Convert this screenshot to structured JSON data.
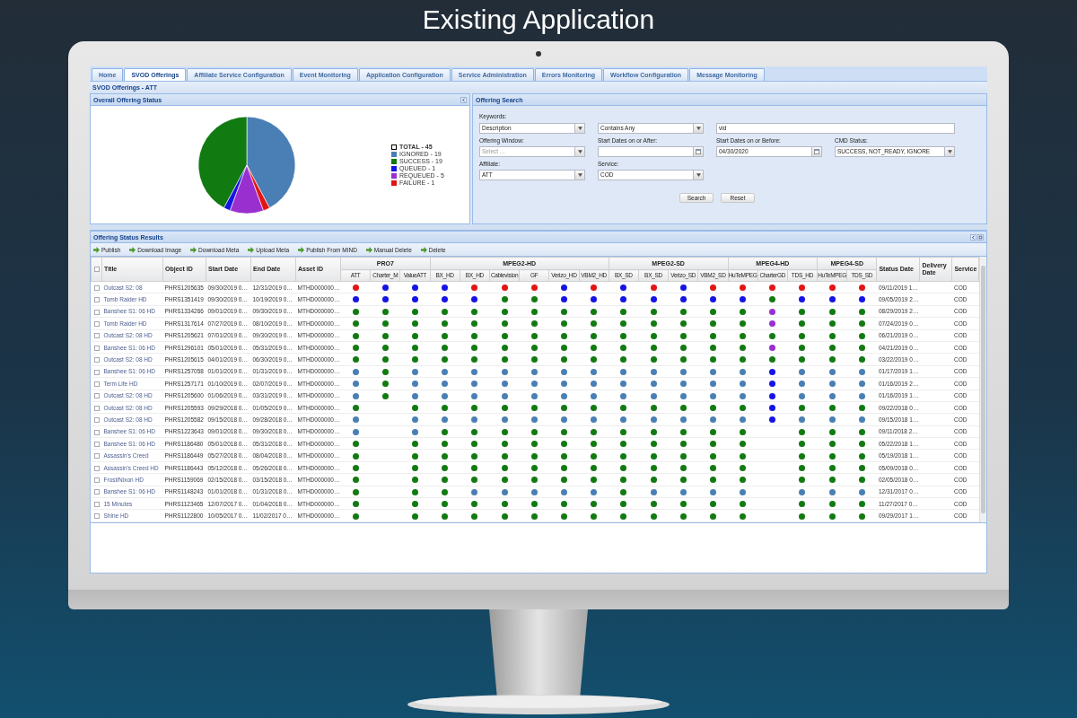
{
  "heading": "Existing Application",
  "tabs": [
    {
      "label": "Home",
      "selected": false
    },
    {
      "label": "SVOD Offerings",
      "selected": true
    },
    {
      "label": "Affiliate Service Configuration",
      "selected": false
    },
    {
      "label": "Event Monitoring",
      "selected": false
    },
    {
      "label": "Application Configuration",
      "selected": false
    },
    {
      "label": "Service Administration",
      "selected": false
    },
    {
      "label": "Errors Monitoring",
      "selected": false
    },
    {
      "label": "Workflow Configuration",
      "selected": false
    },
    {
      "label": "Message Monitoring",
      "selected": false
    }
  ],
  "breadcrumb": "SVOD Offerings - ATT",
  "status_panel": {
    "title": "Overall Offering Status",
    "total_label": "TOTAL - 45",
    "chart_data": {
      "type": "pie",
      "categories": [
        "IGNORED - 19",
        "SUCCESS - 19",
        "QUEUED - 1",
        "REQUEUED - 5",
        "FAILURE - 1"
      ],
      "values": [
        42.2,
        42.2,
        2.2,
        11.2,
        2.2
      ],
      "colors": [
        "#4a7fb5",
        "#117a11",
        "#1414e6",
        "#9a2fd0",
        "#e31414"
      ]
    }
  },
  "search_panel": {
    "title": "Offering Search",
    "keywords": {
      "label": "Keywords:",
      "field": "Description",
      "operator": "Contains Any",
      "value": "vid"
    },
    "filters": [
      {
        "label": "Offering Window:",
        "kind": "select",
        "placeholder": "Select ..."
      },
      {
        "label": "Start Dates on or After:",
        "kind": "date"
      },
      {
        "label": "Start Dates on or Before:",
        "kind": "date",
        "value": "04/30/2020"
      },
      {
        "label": "CMD Status:",
        "kind": "select",
        "value": "SUCCESS, NOT_READY, IGNORE"
      },
      {
        "label": "Affiliate:",
        "kind": "select",
        "value": "ATT"
      },
      {
        "label": "Service:",
        "kind": "select",
        "value": "COD"
      }
    ],
    "buttons": [
      "Search",
      "Reset"
    ]
  },
  "results": {
    "title": "Offering Status Results",
    "toolbar": [
      "Publish",
      "Download Image",
      "Download Meta",
      "Upload Meta",
      "Publish From MIND",
      "Manual Delete",
      "Delete"
    ],
    "table": {
      "select_all_checked": false,
      "lead_columns": [
        "Title",
        "Object ID",
        "Start Date",
        "End Date",
        "Asset ID"
      ],
      "groups": [
        {
          "name": "PRO7",
          "columns": [
            "ATT",
            "Charter_M",
            "ValueATT"
          ]
        },
        {
          "name": "MPEG2-HD",
          "columns": [
            "BX_HD",
            "BX_HD",
            "Cablevision",
            "GF",
            "Verizo_HD",
            "VBM2_HD"
          ]
        },
        {
          "name": "MPEG2-SD",
          "columns": [
            "BX_SD",
            "BX_SD",
            "Verizo_SD",
            "VBM2_SD"
          ]
        },
        {
          "name": "MPEG4-HD",
          "columns": [
            "HuTeMPEG",
            "CharterGD",
            "TDS_HD"
          ]
        },
        {
          "name": "MPEG4-SD",
          "columns": [
            "HuTeMPEG",
            "TDS_SD"
          ]
        }
      ],
      "tail_columns": [
        "Status Date",
        "Delivery Date",
        "Service"
      ],
      "rows": [
        {
          "checked": false,
          "title": "Outcast S2: 08",
          "object_id": "PHRS1205635",
          "start_date": "09/30/2019 0…",
          "end_date": "12/31/2019 0…",
          "asset_id": "MTHD000000…",
          "status_date": "09/11/2019 1…",
          "service": "COD",
          "statuses": [
            {
              "color": "#e31414"
            },
            {
              "color": "#1414e6"
            },
            {
              "color": "#1414e6"
            },
            {
              "color": "#1414e6"
            },
            {
              "color": "#e31414"
            },
            {
              "color": "#e31414"
            },
            {
              "color": "#e31414"
            },
            {
              "color": "#1414e6"
            },
            {
              "color": "#e31414"
            },
            {
              "color": "#1414e6"
            },
            {
              "color": "#e31414"
            },
            {
              "color": "#1414e6"
            },
            {
              "color": "#e31414"
            },
            {
              "color": "#e31414"
            },
            {
              "color": "#e31414"
            },
            {
              "color": "#e31414"
            },
            {
              "color": "#e31414"
            },
            {
              "color": "#e31414"
            }
          ]
        },
        {
          "checked": false,
          "title": "Tomb Raider HD",
          "object_id": "PHRS1351419",
          "start_date": "09/30/2019 0…",
          "end_date": "10/19/2019 0…",
          "asset_id": "MTHD000000…",
          "status_date": "09/05/2019 2…",
          "service": "COD",
          "statuses": [
            {
              "color": "#1414e6"
            },
            {
              "color": "#1414e6"
            },
            {
              "color": "#1414e6"
            },
            {
              "color": "#1414e6"
            },
            {
              "color": "#1414e6"
            },
            {
              "color": "#117a11"
            },
            {
              "color": "#117a11"
            },
            {
              "color": "#1414e6"
            },
            {
              "color": "#1414e6"
            },
            {
              "color": "#1414e6"
            },
            {
              "color": "#1414e6"
            },
            {
              "color": "#1414e6"
            },
            {
              "color": "#1414e6"
            },
            {
              "color": "#1414e6"
            },
            {
              "color": "#117a11"
            },
            {
              "color": "#1414e6"
            },
            {
              "color": "#1414e6"
            },
            {
              "color": "#1414e6"
            }
          ]
        },
        {
          "checked": false,
          "title": "Banshee S1: 06 HD",
          "object_id": "PHRS1334266",
          "start_date": "09/01/2019 0…",
          "end_date": "09/30/2019 0…",
          "asset_id": "MTHD000000…",
          "status_date": "08/29/2019 2…",
          "service": "COD",
          "statuses": [
            {
              "color": "#117a11"
            },
            {
              "color": "#117a11"
            },
            {
              "color": "#117a11"
            },
            {
              "color": "#117a11"
            },
            {
              "color": "#117a11"
            },
            {
              "color": "#117a11"
            },
            {
              "color": "#117a11"
            },
            {
              "color": "#117a11"
            },
            {
              "color": "#117a11"
            },
            {
              "color": "#117a11"
            },
            {
              "color": "#117a11"
            },
            {
              "color": "#117a11"
            },
            {
              "color": "#117a11"
            },
            {
              "color": "#117a11"
            },
            {
              "color": "#9a2fd0"
            },
            {
              "color": "#117a11"
            },
            {
              "color": "#117a11"
            },
            {
              "color": "#117a11"
            }
          ]
        },
        {
          "checked": false,
          "title": "Tomb Raider HD",
          "object_id": "PHRS1317614",
          "start_date": "07/27/2019 0…",
          "end_date": "08/10/2019 0…",
          "asset_id": "MTHD000000…",
          "status_date": "07/24/2019 0…",
          "service": "COD",
          "statuses": [
            {
              "color": "#117a11"
            },
            {
              "color": "#117a11"
            },
            {
              "color": "#117a11"
            },
            {
              "color": "#117a11"
            },
            {
              "color": "#117a11"
            },
            {
              "color": "#117a11"
            },
            {
              "color": "#117a11"
            },
            {
              "color": "#117a11"
            },
            {
              "color": "#117a11"
            },
            {
              "color": "#117a11"
            },
            {
              "color": "#117a11"
            },
            {
              "color": "#117a11"
            },
            {
              "color": "#117a11"
            },
            {
              "color": "#117a11"
            },
            {
              "color": "#9a2fd0"
            },
            {
              "color": "#117a11"
            },
            {
              "color": "#117a11"
            },
            {
              "color": "#117a11"
            }
          ]
        },
        {
          "checked": false,
          "title": "Outcast S2: 08 HD",
          "object_id": "PHRS1205621",
          "start_date": "07/01/2019 0…",
          "end_date": "09/30/2019 0…",
          "asset_id": "MTHD000000…",
          "status_date": "06/21/2019 0…",
          "service": "COD",
          "statuses": [
            {
              "color": "#117a11"
            },
            {
              "color": "#117a11"
            },
            {
              "color": "#117a11"
            },
            {
              "color": "#117a11"
            },
            {
              "color": "#117a11"
            },
            {
              "color": "#117a11"
            },
            {
              "color": "#117a11"
            },
            {
              "color": "#117a11"
            },
            {
              "color": "#117a11"
            },
            {
              "color": "#117a11"
            },
            {
              "color": "#117a11"
            },
            {
              "color": "#117a11"
            },
            {
              "color": "#117a11"
            },
            {
              "color": "#117a11"
            },
            {
              "color": "#117a11"
            },
            {
              "color": "#117a11"
            },
            {
              "color": "#117a11"
            },
            {
              "color": "#117a11"
            }
          ]
        },
        {
          "checked": false,
          "title": "Banshee S1: 06 HD",
          "object_id": "PHRS1296101",
          "start_date": "05/01/2019 0…",
          "end_date": "05/31/2019 0…",
          "asset_id": "MTHD000000…",
          "status_date": "04/21/2019 0…",
          "service": "COD",
          "statuses": [
            {
              "color": "#117a11"
            },
            {
              "color": "#117a11"
            },
            {
              "color": "#117a11"
            },
            {
              "color": "#117a11"
            },
            {
              "color": "#117a11"
            },
            {
              "color": "#117a11"
            },
            {
              "color": "#117a11"
            },
            {
              "color": "#117a11"
            },
            {
              "color": "#117a11"
            },
            {
              "color": "#117a11"
            },
            {
              "color": "#117a11"
            },
            {
              "color": "#117a11"
            },
            {
              "color": "#117a11"
            },
            {
              "color": "#117a11"
            },
            {
              "color": "#9a2fd0"
            },
            {
              "color": "#117a11"
            },
            {
              "color": "#117a11"
            },
            {
              "color": "#117a11"
            }
          ]
        },
        {
          "checked": false,
          "title": "Outcast S2: 08 HD",
          "object_id": "PHRS1205615",
          "start_date": "04/01/2019 0…",
          "end_date": "06/30/2019 0…",
          "asset_id": "MTHD000000…",
          "status_date": "03/22/2019 0…",
          "service": "COD",
          "statuses": [
            {
              "color": "#117a11"
            },
            {
              "color": "#117a11"
            },
            {
              "color": "#117a11"
            },
            {
              "color": "#117a11"
            },
            {
              "color": "#117a11"
            },
            {
              "color": "#117a11"
            },
            {
              "color": "#117a11"
            },
            {
              "color": "#117a11"
            },
            {
              "color": "#117a11"
            },
            {
              "color": "#117a11"
            },
            {
              "color": "#117a11"
            },
            {
              "color": "#117a11"
            },
            {
              "color": "#117a11"
            },
            {
              "color": "#117a11"
            },
            {
              "color": "#117a11"
            },
            {
              "color": "#117a11"
            },
            {
              "color": "#117a11"
            },
            {
              "color": "#117a11"
            }
          ]
        },
        {
          "checked": false,
          "title": "Banshee S1: 06 HD",
          "object_id": "PHRS1257058",
          "start_date": "01/01/2019 0…",
          "end_date": "01/31/2019 0…",
          "asset_id": "MTHD000000…",
          "status_date": "01/17/2019 1…",
          "service": "COD",
          "statuses": [
            {
              "color": "#4a7fb5"
            },
            {
              "color": "#117a11"
            },
            {
              "color": "#4a7fb5"
            },
            {
              "color": "#4a7fb5"
            },
            {
              "color": "#4a7fb5"
            },
            {
              "color": "#4a7fb5"
            },
            {
              "color": "#4a7fb5"
            },
            {
              "color": "#4a7fb5"
            },
            {
              "color": "#4a7fb5"
            },
            {
              "color": "#4a7fb5"
            },
            {
              "color": "#4a7fb5"
            },
            {
              "color": "#4a7fb5"
            },
            {
              "color": "#4a7fb5"
            },
            {
              "color": "#4a7fb5"
            },
            {
              "color": "#1414e6"
            },
            {
              "color": "#4a7fb5"
            },
            {
              "color": "#4a7fb5"
            },
            {
              "color": "#4a7fb5"
            }
          ]
        },
        {
          "checked": false,
          "title": "Term Life HD",
          "object_id": "PHRS1257171",
          "start_date": "01/10/2019 0…",
          "end_date": "02/07/2019 0…",
          "asset_id": "MTHD000000…",
          "status_date": "01/16/2019 2…",
          "service": "COD",
          "statuses": [
            {
              "color": "#4a7fb5"
            },
            {
              "color": "#117a11"
            },
            {
              "color": "#4a7fb5"
            },
            {
              "color": "#4a7fb5"
            },
            {
              "color": "#4a7fb5"
            },
            {
              "color": "#4a7fb5"
            },
            {
              "color": "#4a7fb5"
            },
            {
              "color": "#4a7fb5"
            },
            {
              "color": "#4a7fb5"
            },
            {
              "color": "#4a7fb5"
            },
            {
              "color": "#4a7fb5"
            },
            {
              "color": "#4a7fb5"
            },
            {
              "color": "#4a7fb5"
            },
            {
              "color": "#4a7fb5"
            },
            {
              "color": "#1414e6"
            },
            {
              "color": "#4a7fb5"
            },
            {
              "color": "#4a7fb5"
            },
            {
              "color": "#4a7fb5"
            }
          ]
        },
        {
          "checked": false,
          "title": "Outcast S2: 08 HD",
          "object_id": "PHRS1205600",
          "start_date": "01/06/2019 0…",
          "end_date": "03/31/2019 0…",
          "asset_id": "MTHD000000…",
          "status_date": "01/16/2019 1…",
          "service": "COD",
          "statuses": [
            {
              "color": "#4a7fb5"
            },
            {
              "color": "#117a11"
            },
            {
              "color": "#4a7fb5"
            },
            {
              "color": "#4a7fb5"
            },
            {
              "color": "#4a7fb5"
            },
            {
              "color": "#4a7fb5"
            },
            {
              "color": "#4a7fb5"
            },
            {
              "color": "#4a7fb5"
            },
            {
              "color": "#4a7fb5"
            },
            {
              "color": "#4a7fb5"
            },
            {
              "color": "#4a7fb5"
            },
            {
              "color": "#4a7fb5"
            },
            {
              "color": "#4a7fb5"
            },
            {
              "color": "#4a7fb5"
            },
            {
              "color": "#1414e6"
            },
            {
              "color": "#4a7fb5"
            },
            {
              "color": "#4a7fb5"
            },
            {
              "color": "#4a7fb5"
            }
          ]
        },
        {
          "checked": false,
          "title": "Outcast S2: 08 HD",
          "object_id": "PHRS1205593",
          "start_date": "09/29/2018 0…",
          "end_date": "01/05/2019 0…",
          "asset_id": "MTHD000000…",
          "status_date": "09/22/2018 0…",
          "service": "COD",
          "statuses": [
            {
              "color": "#117a11"
            },
            {
              "empty": true
            },
            {
              "color": "#117a11"
            },
            {
              "color": "#117a11"
            },
            {
              "color": "#117a11"
            },
            {
              "color": "#117a11"
            },
            {
              "color": "#117a11"
            },
            {
              "color": "#117a11"
            },
            {
              "color": "#117a11"
            },
            {
              "color": "#117a11"
            },
            {
              "color": "#117a11"
            },
            {
              "color": "#117a11"
            },
            {
              "color": "#117a11"
            },
            {
              "color": "#117a11"
            },
            {
              "color": "#1414e6"
            },
            {
              "color": "#117a11"
            },
            {
              "color": "#117a11"
            },
            {
              "color": "#117a11"
            }
          ]
        },
        {
          "checked": false,
          "title": "Outcast S2: 08 HD",
          "object_id": "PHRS1205582",
          "start_date": "09/15/2018 0…",
          "end_date": "09/28/2018 0…",
          "asset_id": "MTHD000000…",
          "status_date": "09/15/2018 1…",
          "service": "COD",
          "statuses": [
            {
              "color": "#4a7fb5"
            },
            {
              "empty": true
            },
            {
              "color": "#4a7fb5"
            },
            {
              "color": "#4a7fb5"
            },
            {
              "color": "#4a7fb5"
            },
            {
              "color": "#4a7fb5"
            },
            {
              "color": "#4a7fb5"
            },
            {
              "color": "#4a7fb5"
            },
            {
              "color": "#4a7fb5"
            },
            {
              "color": "#4a7fb5"
            },
            {
              "color": "#4a7fb5"
            },
            {
              "color": "#4a7fb5"
            },
            {
              "color": "#4a7fb5"
            },
            {
              "color": "#4a7fb5"
            },
            {
              "color": "#1414e6"
            },
            {
              "color": "#4a7fb5"
            },
            {
              "color": "#4a7fb5"
            },
            {
              "color": "#4a7fb5"
            }
          ]
        },
        {
          "checked": false,
          "title": "Banshee S1: 06 HD",
          "object_id": "PHRS1223643",
          "start_date": "09/01/2018 0…",
          "end_date": "09/30/2018 0…",
          "asset_id": "MTHD000000…",
          "status_date": "09/11/2018 2…",
          "service": "COD",
          "statuses": [
            {
              "color": "#4a7fb5"
            },
            {
              "empty": true
            },
            {
              "color": "#4a7fb5"
            },
            {
              "color": "#117a11"
            },
            {
              "color": "#117a11"
            },
            {
              "color": "#117a11"
            },
            {
              "color": "#117a11"
            },
            {
              "color": "#117a11"
            },
            {
              "color": "#117a11"
            },
            {
              "color": "#117a11"
            },
            {
              "color": "#117a11"
            },
            {
              "color": "#117a11"
            },
            {
              "color": "#117a11"
            },
            {
              "color": "#117a11"
            },
            {
              "empty": true
            },
            {
              "color": "#117a11"
            },
            {
              "color": "#117a11"
            },
            {
              "color": "#117a11"
            }
          ]
        },
        {
          "checked": false,
          "title": "Banshee S1: 06 HD",
          "object_id": "PHRS1186480",
          "start_date": "05/01/2018 0…",
          "end_date": "05/31/2018 0…",
          "asset_id": "MTHD000000…",
          "status_date": "05/22/2018 1…",
          "service": "COD",
          "statuses": [
            {
              "color": "#117a11"
            },
            {
              "empty": true
            },
            {
              "color": "#117a11"
            },
            {
              "color": "#117a11"
            },
            {
              "color": "#117a11"
            },
            {
              "color": "#117a11"
            },
            {
              "color": "#117a11"
            },
            {
              "color": "#117a11"
            },
            {
              "color": "#117a11"
            },
            {
              "color": "#117a11"
            },
            {
              "color": "#117a11"
            },
            {
              "color": "#117a11"
            },
            {
              "color": "#117a11"
            },
            {
              "color": "#117a11"
            },
            {
              "empty": true
            },
            {
              "color": "#117a11"
            },
            {
              "color": "#117a11"
            },
            {
              "color": "#117a11"
            }
          ]
        },
        {
          "checked": false,
          "title": "Assassin's Creed",
          "object_id": "PHRS1186449",
          "start_date": "05/27/2018 0…",
          "end_date": "08/04/2018 0…",
          "asset_id": "MTHD000000…",
          "status_date": "05/19/2018 1…",
          "service": "COD",
          "statuses": [
            {
              "color": "#117a11"
            },
            {
              "empty": true
            },
            {
              "color": "#117a11"
            },
            {
              "color": "#117a11"
            },
            {
              "color": "#117a11"
            },
            {
              "color": "#117a11"
            },
            {
              "color": "#117a11"
            },
            {
              "color": "#117a11"
            },
            {
              "color": "#117a11"
            },
            {
              "color": "#117a11"
            },
            {
              "color": "#117a11"
            },
            {
              "color": "#117a11"
            },
            {
              "color": "#117a11"
            },
            {
              "color": "#117a11"
            },
            {
              "empty": true
            },
            {
              "color": "#117a11"
            },
            {
              "color": "#117a11"
            },
            {
              "color": "#117a11"
            }
          ]
        },
        {
          "checked": false,
          "title": "Assassin's Creed HD",
          "object_id": "PHRS1186443",
          "start_date": "05/12/2018 0…",
          "end_date": "05/26/2018 0…",
          "asset_id": "MTHD000000…",
          "status_date": "05/09/2018 0…",
          "service": "COD",
          "statuses": [
            {
              "color": "#117a11"
            },
            {
              "empty": true
            },
            {
              "color": "#117a11"
            },
            {
              "color": "#117a11"
            },
            {
              "color": "#117a11"
            },
            {
              "color": "#117a11"
            },
            {
              "color": "#117a11"
            },
            {
              "color": "#117a11"
            },
            {
              "color": "#117a11"
            },
            {
              "color": "#117a11"
            },
            {
              "color": "#117a11"
            },
            {
              "color": "#117a11"
            },
            {
              "color": "#117a11"
            },
            {
              "color": "#117a11"
            },
            {
              "empty": true
            },
            {
              "color": "#117a11"
            },
            {
              "color": "#117a11"
            },
            {
              "color": "#117a11"
            }
          ]
        },
        {
          "checked": false,
          "title": "Frost/Nixon HD",
          "object_id": "PHRS1159069",
          "start_date": "02/15/2018 0…",
          "end_date": "03/15/2018 0…",
          "asset_id": "MTHD000000…",
          "status_date": "02/05/2018 0…",
          "service": "COD",
          "statuses": [
            {
              "color": "#117a11"
            },
            {
              "empty": true
            },
            {
              "color": "#117a11"
            },
            {
              "color": "#117a11"
            },
            {
              "color": "#117a11"
            },
            {
              "color": "#117a11"
            },
            {
              "color": "#117a11"
            },
            {
              "color": "#117a11"
            },
            {
              "color": "#117a11"
            },
            {
              "color": "#117a11"
            },
            {
              "color": "#117a11"
            },
            {
              "color": "#117a11"
            },
            {
              "color": "#117a11"
            },
            {
              "color": "#117a11"
            },
            {
              "empty": true
            },
            {
              "color": "#117a11"
            },
            {
              "color": "#117a11"
            },
            {
              "color": "#117a11"
            }
          ]
        },
        {
          "checked": false,
          "title": "Banshee S1: 06 HD",
          "object_id": "PHRS1148243",
          "start_date": "01/01/2018 0…",
          "end_date": "01/31/2018 0…",
          "asset_id": "MTHD000000…",
          "status_date": "12/31/2017 0…",
          "service": "COD",
          "statuses": [
            {
              "color": "#117a11"
            },
            {
              "empty": true
            },
            {
              "color": "#117a11"
            },
            {
              "color": "#117a11"
            },
            {
              "color": "#4a7fb5"
            },
            {
              "color": "#4a7fb5"
            },
            {
              "color": "#4a7fb5"
            },
            {
              "color": "#4a7fb5"
            },
            {
              "color": "#4a7fb5"
            },
            {
              "color": "#117a11"
            },
            {
              "color": "#4a7fb5"
            },
            {
              "color": "#4a7fb5"
            },
            {
              "color": "#4a7fb5"
            },
            {
              "color": "#4a7fb5"
            },
            {
              "empty": true
            },
            {
              "color": "#4a7fb5"
            },
            {
              "color": "#4a7fb5"
            },
            {
              "color": "#4a7fb5"
            }
          ]
        },
        {
          "checked": false,
          "title": "15 Minutes",
          "object_id": "PHRS1123465",
          "start_date": "12/07/2017 0…",
          "end_date": "01/04/2018 0…",
          "asset_id": "MTHD000000…",
          "status_date": "11/27/2017 0…",
          "service": "COD",
          "statuses": [
            {
              "color": "#117a11"
            },
            {
              "empty": true
            },
            {
              "color": "#117a11"
            },
            {
              "color": "#117a11"
            },
            {
              "color": "#117a11"
            },
            {
              "color": "#117a11"
            },
            {
              "color": "#117a11"
            },
            {
              "color": "#117a11"
            },
            {
              "color": "#117a11"
            },
            {
              "color": "#117a11"
            },
            {
              "color": "#117a11"
            },
            {
              "color": "#117a11"
            },
            {
              "color": "#117a11"
            },
            {
              "color": "#117a11"
            },
            {
              "empty": true
            },
            {
              "color": "#117a11"
            },
            {
              "color": "#117a11"
            },
            {
              "color": "#117a11"
            }
          ]
        },
        {
          "checked": false,
          "title": "Shine HD",
          "object_id": "PHRS1122800",
          "start_date": "10/05/2017 0…",
          "end_date": "11/02/2017 0…",
          "asset_id": "MTHD000000…",
          "status_date": "09/29/2017 1…",
          "service": "COD",
          "statuses": [
            {
              "color": "#117a11"
            },
            {
              "empty": true
            },
            {
              "color": "#117a11"
            },
            {
              "color": "#117a11"
            },
            {
              "color": "#117a11"
            },
            {
              "color": "#117a11"
            },
            {
              "color": "#117a11"
            },
            {
              "color": "#117a11"
            },
            {
              "color": "#117a11"
            },
            {
              "color": "#117a11"
            },
            {
              "color": "#117a11"
            },
            {
              "color": "#117a11"
            },
            {
              "color": "#117a11"
            },
            {
              "color": "#117a11"
            },
            {
              "empty": true
            },
            {
              "color": "#117a11"
            },
            {
              "color": "#117a11"
            },
            {
              "color": "#117a11"
            }
          ]
        }
      ]
    }
  }
}
